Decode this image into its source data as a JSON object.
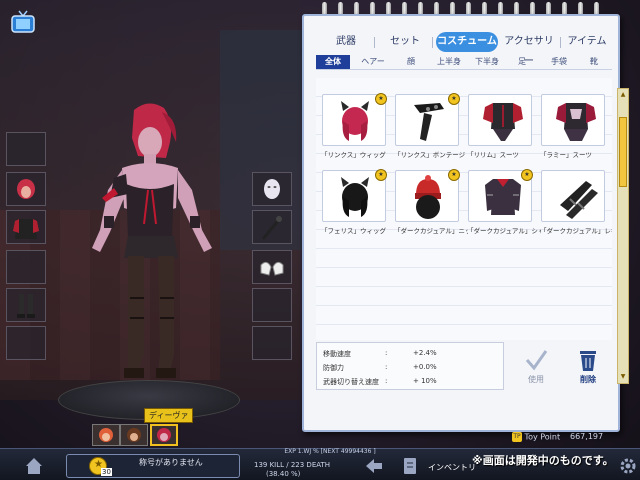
{
  "tabs": [
    {
      "label": "武器",
      "active": false
    },
    {
      "label": "セット",
      "active": false
    },
    {
      "label": "コスチューム",
      "active": true
    },
    {
      "label": "アクセサリー",
      "active": false
    },
    {
      "label": "アイテム",
      "active": false
    }
  ],
  "subtabs": [
    {
      "label": "全体",
      "active": true
    },
    {
      "label": "ヘアー",
      "active": false
    },
    {
      "label": "顔",
      "active": false
    },
    {
      "label": "上半身",
      "active": false
    },
    {
      "label": "下半身",
      "active": false
    },
    {
      "label": "足",
      "active": false
    },
    {
      "label": "手袋",
      "active": false
    },
    {
      "label": "靴",
      "active": false
    }
  ],
  "items": [
    {
      "label": "「リンクス」ウィッグ",
      "icon": "wig-icon",
      "badge": true
    },
    {
      "label": "「リンクス」ボンテージ",
      "icon": "bondage-icon",
      "badge": true
    },
    {
      "label": "「リリム」スーツ",
      "icon": "suit-icon",
      "badge": false
    },
    {
      "label": "「ラミー」スーツ",
      "icon": "suit-icon",
      "badge": false
    },
    {
      "label": "「フェリス」ウィッグ",
      "icon": "wig-icon",
      "badge": true
    },
    {
      "label": "「ダークカジュアル」ニット帽",
      "icon": "beanie-icon",
      "badge": true
    },
    {
      "label": "「ダークカジュアル」シャツ",
      "icon": "shirt-icon",
      "badge": true
    },
    {
      "label": "「ダークカジュアル」レギンス",
      "icon": "leggings-icon",
      "badge": false
    }
  ],
  "stats": [
    {
      "label": "移動速度",
      "sep": ":",
      "value": "+2.4%"
    },
    {
      "label": "防御力",
      "sep": ":",
      "value": "+0.0%"
    },
    {
      "label": "武器切り替え速度",
      "sep": ":",
      "value": "+ 10%"
    }
  ],
  "actions": {
    "use": "使用",
    "delete": "削除"
  },
  "toy_point": {
    "label": "Toy Point",
    "value": "667,197"
  },
  "character": {
    "name": "ディーヴァ"
  },
  "player": {
    "title": "称号がありません",
    "level": "30"
  },
  "exp": {
    "text": "EXP   1.WJ % [NEXT  49994436 ]"
  },
  "killdeath": {
    "line1": "139 KILL / 223 DEATH",
    "line2": "(38.40 %)"
  },
  "inventory_label": "インベントリ",
  "notice": "※画面は開発中のものです。",
  "colors": {
    "active_tab": "#3a8fe0",
    "active_subtab": "#1f3f9a",
    "badge": "#f2c420",
    "selected_frame": "#f0c020"
  }
}
